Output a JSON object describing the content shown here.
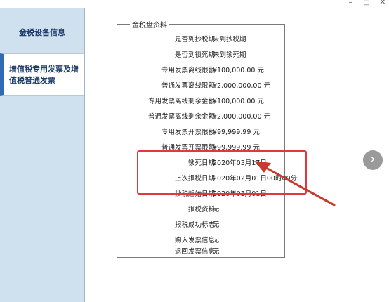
{
  "window": {
    "min_icon": "–",
    "max_icon": "□",
    "close_icon": "✕"
  },
  "sidebar": {
    "items": [
      {
        "label": "金税设备信息"
      },
      {
        "label": "增值税专用发票及增值税普通发票"
      }
    ]
  },
  "panel": {
    "title": "金税盘资料",
    "rows": [
      {
        "label": "是否到抄税期",
        "value": "未到抄税期"
      },
      {
        "label": "是否到锁死期",
        "value": "未到锁死期"
      },
      {
        "label": "专用发票离线限额",
        "value": "¥100,000.00 元"
      },
      {
        "label": "普通发票离线限额",
        "value": "¥2,000,000.00 元"
      },
      {
        "label": "专用发票离线剩余金额",
        "value": "¥100,000.00 元"
      },
      {
        "label": "普通发票离线剩余金额",
        "value": "¥2,000,000.00 元"
      },
      {
        "label": "专用发票开票限额",
        "value": "¥99,999.99 元"
      },
      {
        "label": "普通发票开票限额",
        "value": "¥99,999.99 元"
      },
      {
        "label": "锁死日期",
        "value": "2020年03月17日"
      },
      {
        "label": "上次报税日期",
        "value": "2020年02月01日00时00分"
      },
      {
        "label": "抄税起始日期",
        "value": "2020年03月01日"
      },
      {
        "label": "报税资料",
        "value": "无"
      },
      {
        "label": "报税成功标志",
        "value": "无"
      },
      {
        "label": "购入发票信息",
        "value": "无"
      },
      {
        "label": "退回发票信息",
        "value": "无"
      }
    ]
  },
  "next_icon": "›",
  "colors": {
    "highlight": "#e0383b",
    "sidebar_bg": "#cfe0ef",
    "accent": "#2e6db4"
  }
}
